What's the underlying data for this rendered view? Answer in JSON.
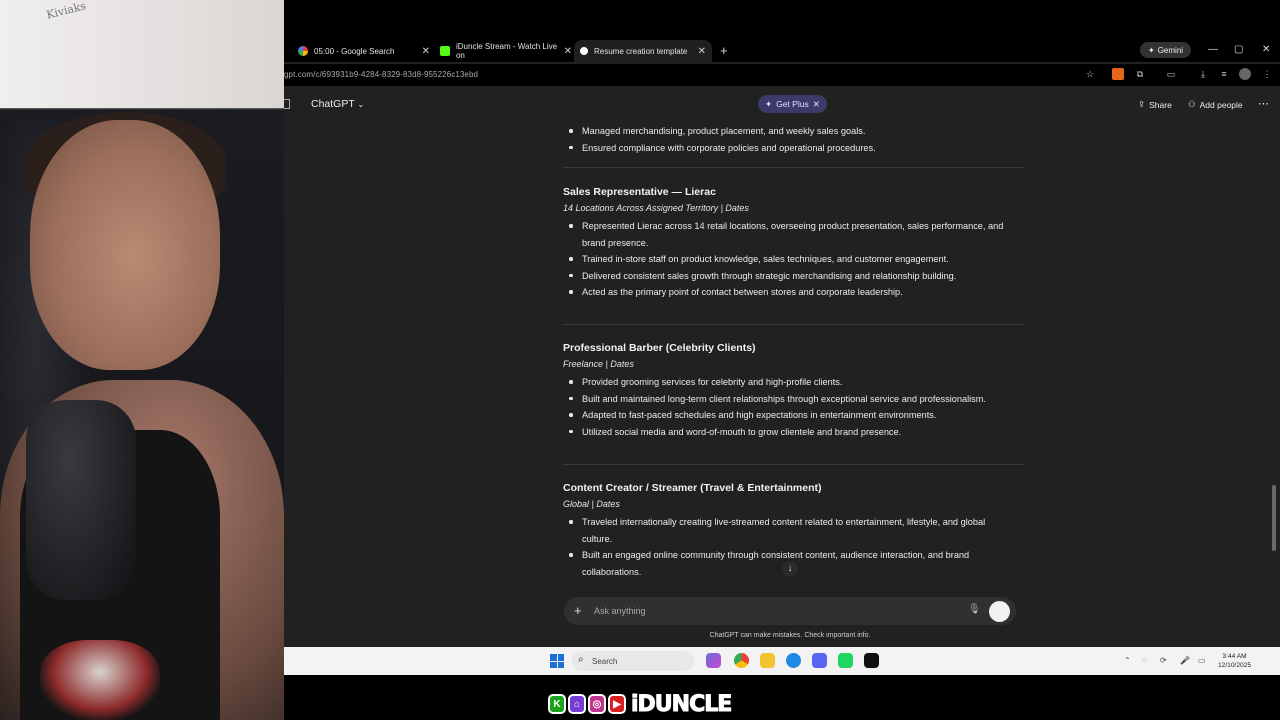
{
  "browser": {
    "tabs": [
      {
        "label": "05:00 - Google Search",
        "icon": "google-icon"
      },
      {
        "label": "iDuncle Stream - Watch Live on",
        "icon": "kick-icon"
      },
      {
        "label": "Resume creation template",
        "icon": "chatgpt-icon",
        "active": true
      }
    ],
    "gemini_label": "Gemini",
    "url": "gpt.com/c/693931b9-4284-8329-83d8-955226c13ebd"
  },
  "app": {
    "model_label": "ChatGPT",
    "get_plus_label": "Get Plus",
    "share_label": "Share",
    "add_people_label": "Add people"
  },
  "content": {
    "prev_bullets": [
      "Managed merchandising, product placement, and weekly sales goals.",
      "Ensured compliance with corporate policies and operational procedures."
    ],
    "jobs": [
      {
        "title": "Sales Representative — Lierac",
        "sub": "14 Locations Across Assigned Territory | Dates",
        "bullets": [
          "Represented Lierac across 14 retail locations, overseeing product presentation, sales performance, and",
          "brand presence.",
          "Trained in-store staff on product knowledge, sales techniques, and customer engagement.",
          "Delivered consistent sales growth through strategic merchandising and relationship building.",
          "Acted as the primary point of contact between stores and corporate leadership."
        ]
      },
      {
        "title": "Professional Barber (Celebrity Clients)",
        "sub": "Freelance | Dates",
        "bullets": [
          "Provided grooming services for celebrity and high-profile clients.",
          "Built and maintained long-term client relationships through exceptional service and professionalism.",
          "Adapted to fast-paced schedules and high expectations in entertainment environments.",
          "Utilized social media and word-of-mouth to grow clientele and brand presence."
        ]
      },
      {
        "title": "Content Creator / Streamer (Travel & Entertainment)",
        "sub": "Global | Dates",
        "bullets": [
          "Traveled internationally creating live-streamed content related to entertainment, lifestyle, and global",
          "culture.",
          "Built an engaged online community through consistent content, audience interaction, and brand",
          "collaborations."
        ]
      }
    ]
  },
  "composer": {
    "placeholder": "Ask anything",
    "disclaimer": "ChatGPT can make mistakes. Check important info."
  },
  "taskbar": {
    "search_label": "Search",
    "time": "3:44 AM",
    "date": "12/10/2025"
  },
  "overlay": {
    "wall_text": "Kiviaks",
    "brand": "iDUNCLE",
    "social_icons": [
      "kick-icon",
      "twitch-icon",
      "instagram-icon",
      "youtube-icon"
    ]
  },
  "colors": {
    "chat_bg": "#212121",
    "get_plus_bg": "#3c3a68",
    "text": "#ececec"
  }
}
